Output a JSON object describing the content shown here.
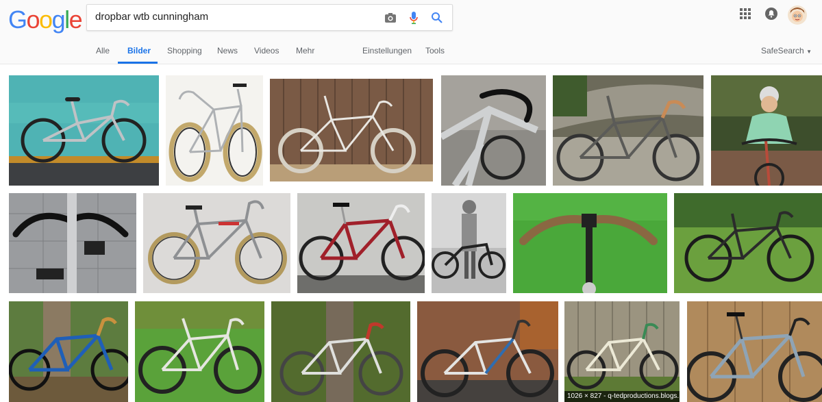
{
  "logo": {
    "letters": [
      "G",
      "o",
      "o",
      "g",
      "l",
      "e"
    ]
  },
  "search": {
    "query": "dropbar wtb cunningham"
  },
  "tabs": {
    "all": "Alle",
    "images": "Bilder",
    "shopping": "Shopping",
    "news": "News",
    "videos": "Videos",
    "more": "Mehr",
    "settings": "Einstellungen",
    "tools": "Tools"
  },
  "safesearch": {
    "label": "SafeSearch"
  },
  "caption": {
    "text": "1026 × 827 - q-tedproductions.blogs..."
  },
  "results": [
    {
      "kind": "beach-silver-mtb"
    },
    {
      "kind": "illustration-tan-tire"
    },
    {
      "kind": "fence-white-bike"
    },
    {
      "kind": "closeup-dropbar"
    },
    {
      "kind": "gravel-bike"
    },
    {
      "kind": "rider-vintage"
    },
    {
      "kind": "bars-closeup-fence"
    },
    {
      "kind": "gray-roadbike-white"
    },
    {
      "kind": "red-bike-garage"
    },
    {
      "kind": "bw-man-with-bike"
    },
    {
      "kind": "bars-grass-closeup"
    },
    {
      "kind": "black-bike-grass"
    },
    {
      "kind": "blue-bike-tree"
    },
    {
      "kind": "white-bike-grass"
    },
    {
      "kind": "bike-in-yard"
    },
    {
      "kind": "white-blue-bike-wall"
    },
    {
      "kind": "white-bike-fence"
    },
    {
      "kind": "lightblue-bike-wall"
    }
  ]
}
